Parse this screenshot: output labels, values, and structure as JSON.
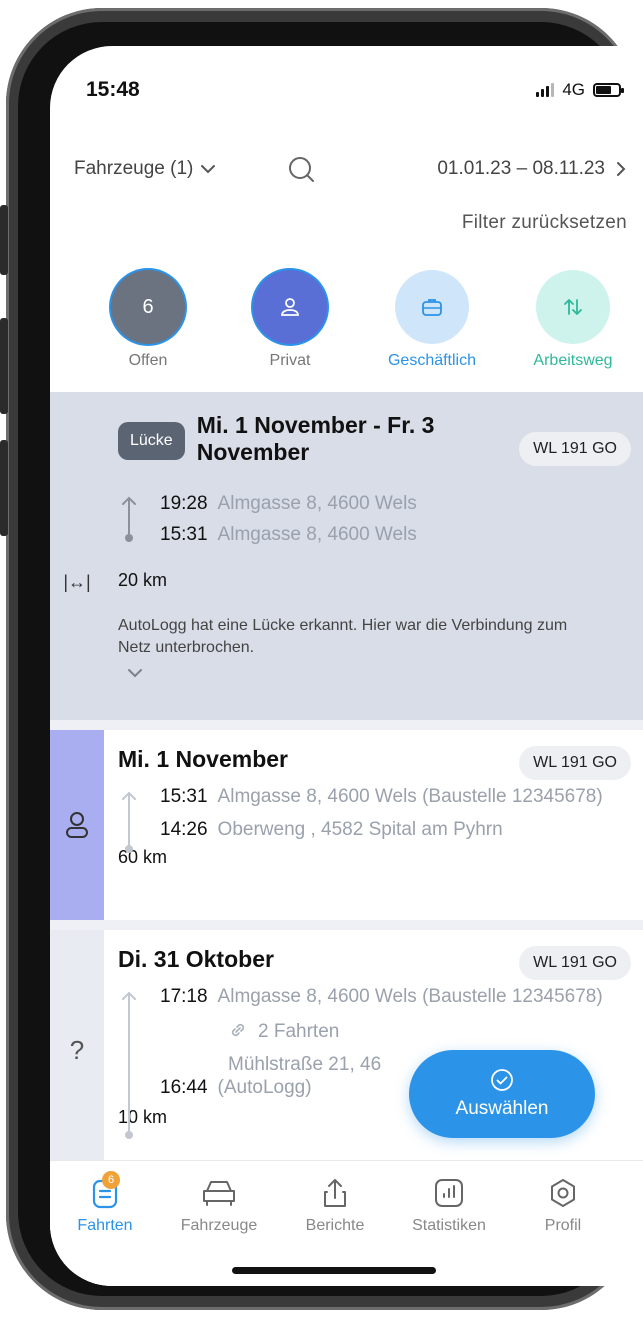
{
  "status_bar": {
    "time": "15:48",
    "network": "4G"
  },
  "filters": {
    "vehicles_label": "Fahrzeuge (1)",
    "date_range": "01.01.23 – 08.11.23",
    "reset_label": "Filter zurücksetzen"
  },
  "chips": [
    {
      "label": "Offen",
      "value": "6",
      "color": "#6b7280"
    },
    {
      "label": "Privat",
      "icon": "person-icon",
      "color": "#5a6fd6"
    },
    {
      "label": "Geschäftlich",
      "icon": "briefcase-icon",
      "color": "#cfe6fa"
    },
    {
      "label": "Arbeitsweg",
      "icon": "arrows-updown-icon",
      "color": "#cdf3ec"
    }
  ],
  "gap_card": {
    "badge": "Lücke",
    "title": "Mi. 1 November - Fr. 3 November",
    "plate": "WL 191 GO",
    "trip_end_time": "19:28",
    "trip_end_addr": "Almgasse 8, 4600 Wels",
    "trip_start_time": "15:31",
    "trip_start_addr": "Almgasse 8, 4600 Wels",
    "distance": "20 km",
    "message": "AutoLogg hat eine Lücke erkannt. Hier war die Verbindung zum Netz unterbrochen.",
    "side_icon": "|↔|"
  },
  "trip1": {
    "title": "Mi. 1 November",
    "plate": "WL 191 GO",
    "end_time": "15:31",
    "end_addr": "Almgasse 8, 4600 Wels (Baustelle 12345678)",
    "start_time": "14:26",
    "start_addr": "Oberweng , 4582 Spital am Pyhrn",
    "distance": "60 km"
  },
  "trip2": {
    "title": "Di. 31 Oktober",
    "plate": "WL 191 GO",
    "end_time": "17:18",
    "end_addr": "Almgasse 8, 4600 Wels (Baustelle 12345678)",
    "linked": "2 Fahrten",
    "start_time": "16:44",
    "start_addr": "Mühlstraße 21, 46",
    "start_addr_2": "(AutoLogg)",
    "distance": "10 km",
    "side_icon": "?"
  },
  "fab": {
    "label": "Auswählen"
  },
  "tabs": [
    {
      "label": "Fahrten",
      "badge": "6",
      "active": true
    },
    {
      "label": "Fahrzeuge"
    },
    {
      "label": "Berichte"
    },
    {
      "label": "Statistiken"
    },
    {
      "label": "Profil"
    }
  ]
}
